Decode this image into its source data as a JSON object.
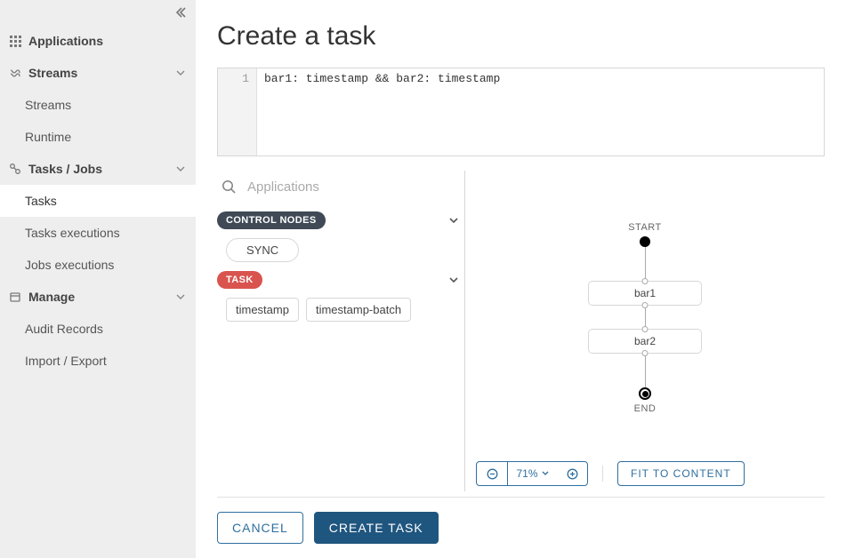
{
  "sidebar": {
    "applications": "Applications",
    "streams_group": "Streams",
    "streams": "Streams",
    "runtime": "Runtime",
    "tasks_group": "Tasks / Jobs",
    "tasks": "Tasks",
    "tasks_exec": "Tasks executions",
    "jobs_exec": "Jobs executions",
    "manage_group": "Manage",
    "audit": "Audit Records",
    "import_export": "Import / Export"
  },
  "page": {
    "title": "Create a task"
  },
  "editor": {
    "line_no": "1",
    "code": "bar1: timestamp && bar2: timestamp"
  },
  "toolbox": {
    "search_placeholder": "Applications",
    "control_label": "CONTROL NODES",
    "control_items": {
      "sync": "SYNC"
    },
    "task_label": "TASK",
    "task_items": {
      "timestamp": "timestamp",
      "timestamp_batch": "timestamp-batch"
    }
  },
  "graph": {
    "start": "START",
    "node1": "bar1",
    "node2": "bar2",
    "end": "END"
  },
  "zoom": {
    "value": "71%",
    "fit": "FIT TO CONTENT"
  },
  "footer": {
    "cancel": "CANCEL",
    "create": "CREATE TASK"
  }
}
